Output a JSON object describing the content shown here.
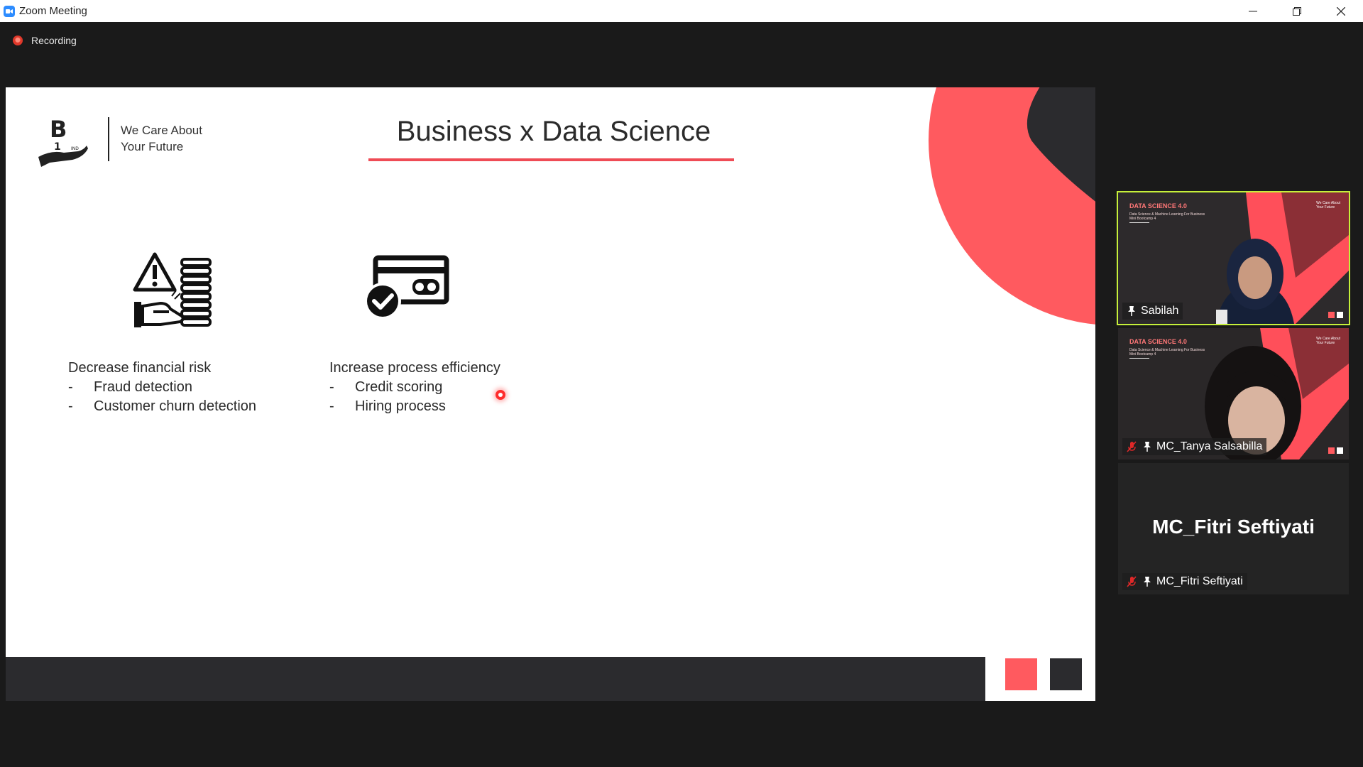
{
  "window": {
    "title": "Zoom Meeting",
    "app_icon": "zoom-camera-icon",
    "controls": [
      "minimize-icon",
      "restore-icon",
      "close-icon"
    ]
  },
  "recording": {
    "label": "Recording",
    "color": "#e0382a"
  },
  "slide": {
    "tagline_line1": "We Care About",
    "tagline_line2": "Your Future",
    "title": "Business x Data Science",
    "accent_color": "#ef4b55",
    "left": {
      "icon": "warning-coins-hand-icon",
      "heading": "Decrease financial risk",
      "items": [
        {
          "dash": "-",
          "text": "Fraud detection"
        },
        {
          "dash": "-",
          "text": "Customer churn detection"
        }
      ]
    },
    "right": {
      "icon": "card-check-icon",
      "heading": "Increase process efficiency",
      "items": [
        {
          "dash": "-",
          "text": "Credit scoring"
        },
        {
          "dash": "-",
          "text": "Hiring process"
        }
      ]
    }
  },
  "participants": [
    {
      "name": "Sabilah",
      "active": true,
      "slide_brand": "DATA SCIENCE 4.0",
      "slide_sub1": "Data Science & Machine Learning For Business",
      "slide_sub2": "Mini Bootcamp 4",
      "slide_care1": "We Care About",
      "slide_care2": "Your Future"
    },
    {
      "name": "MC_Tanya Salsabilla",
      "active": false,
      "muted": true,
      "slide_brand": "DATA SCIENCE 4.0",
      "slide_sub1": "Data Science & Machine Learning For Business",
      "slide_sub2": "Mini Bootcamp 4",
      "slide_care1": "We Care About",
      "slide_care2": "Your Future"
    },
    {
      "name": "MC_Fitri Seftiyati",
      "display_name": "MC_Fitri Seftiyati",
      "active": false,
      "muted": true,
      "video": false
    }
  ]
}
